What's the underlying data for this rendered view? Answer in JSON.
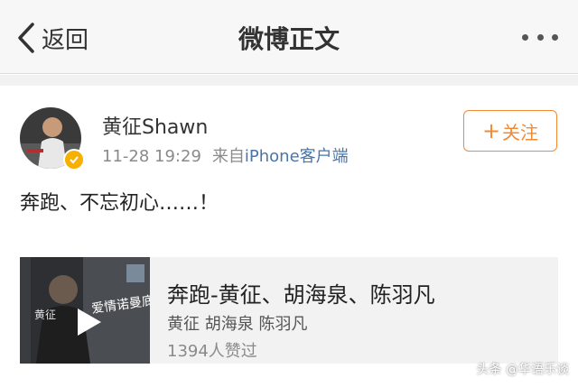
{
  "nav": {
    "back_label": "返回",
    "title": "微博正文"
  },
  "post": {
    "username": "黄征Shawn",
    "time": "11-28 19:29",
    "source_prefix": "来自",
    "source_link": "iPhone客户端",
    "follow_label": "关注",
    "text": "奔跑、不忘初心……！"
  },
  "music_card": {
    "title": "奔跑-黄征、胡海泉、陈羽凡",
    "artists": "黄征 胡海泉 陈羽凡",
    "likes": "1394人赞过",
    "cover_text": "黄征",
    "cover_subtext": "爱情诺曼底"
  },
  "watermark": "头条 @华语乐谈",
  "colors": {
    "accent_orange": "#f08a35",
    "link_blue": "#4a75a8",
    "verified_badge": "#f7b000"
  }
}
